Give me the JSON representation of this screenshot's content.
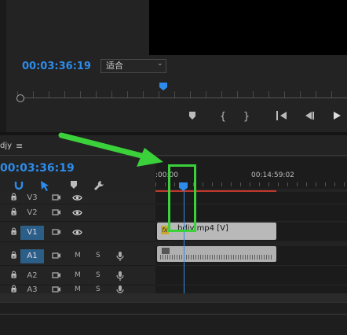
{
  "source_monitor": {
    "timecode": "00:03:36:19",
    "fit_select": "适合",
    "controls": [
      "marker-icon",
      "mark-in-icon",
      "mark-out-icon",
      "go-to-in-icon",
      "step-back-icon",
      "play-icon"
    ]
  },
  "timeline": {
    "sequence_name": "djy",
    "menu_icon": "hamburger-icon",
    "timecode": "00:03:36:19",
    "ruler_start": ":00:00",
    "ruler_end": "00:14:59:02",
    "tools": [
      "snap-icon",
      "linked-selection-icon",
      "marker-icon",
      "wrench-icon"
    ],
    "tracks": [
      {
        "name": "V3",
        "type": "video"
      },
      {
        "name": "V2",
        "type": "video"
      },
      {
        "name": "V1",
        "type": "video",
        "targeted": true
      },
      {
        "name": "A1",
        "type": "audio",
        "targeted": true
      },
      {
        "name": "A2",
        "type": "audio"
      },
      {
        "name": "A3",
        "type": "audio"
      }
    ],
    "audio_buttons": {
      "mute": "M",
      "solo": "S"
    },
    "clips": {
      "video_label": "bdjy mp4 [V]",
      "fx_label": "fx"
    },
    "playhead_fraction": 0.15
  },
  "colors": {
    "timecode": "#2d8ceb",
    "work_area_bar": "#c0392b",
    "target_track": "#2c5f87",
    "annotation": "#3bd13b"
  }
}
